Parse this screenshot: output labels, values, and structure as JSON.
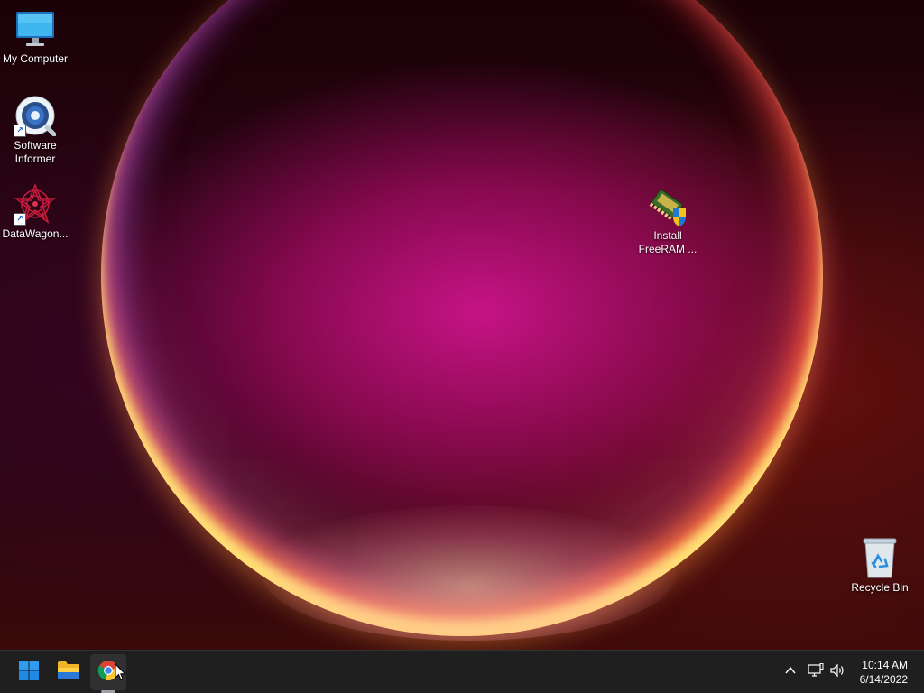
{
  "desktop": {
    "icons": [
      {
        "label": "My Computer",
        "icon": "monitor-icon"
      },
      {
        "label": "Software Informer",
        "icon": "software-informer-icon",
        "shortcut": true
      },
      {
        "label": "DataWagon...",
        "icon": "datawagon-icon",
        "shortcut": true
      },
      {
        "label": "Install FreeRAM ...",
        "icon": "installer-icon"
      },
      {
        "label": "Recycle Bin",
        "icon": "recycle-bin-icon"
      }
    ]
  },
  "taskbar": {
    "apps": [
      {
        "name": "Start",
        "icon": "windows-start-icon"
      },
      {
        "name": "File Explorer",
        "icon": "folder-icon"
      },
      {
        "name": "Google Chrome",
        "icon": "chrome-icon",
        "active": true
      }
    ],
    "tray": {
      "icons": [
        "chevron-up-icon",
        "network-icon",
        "volume-icon"
      ],
      "time": "10:14 AM",
      "date": "6/14/2022"
    }
  },
  "colors": {
    "taskbar_bg": "#1f1f1f",
    "accent": "#c8128a"
  }
}
